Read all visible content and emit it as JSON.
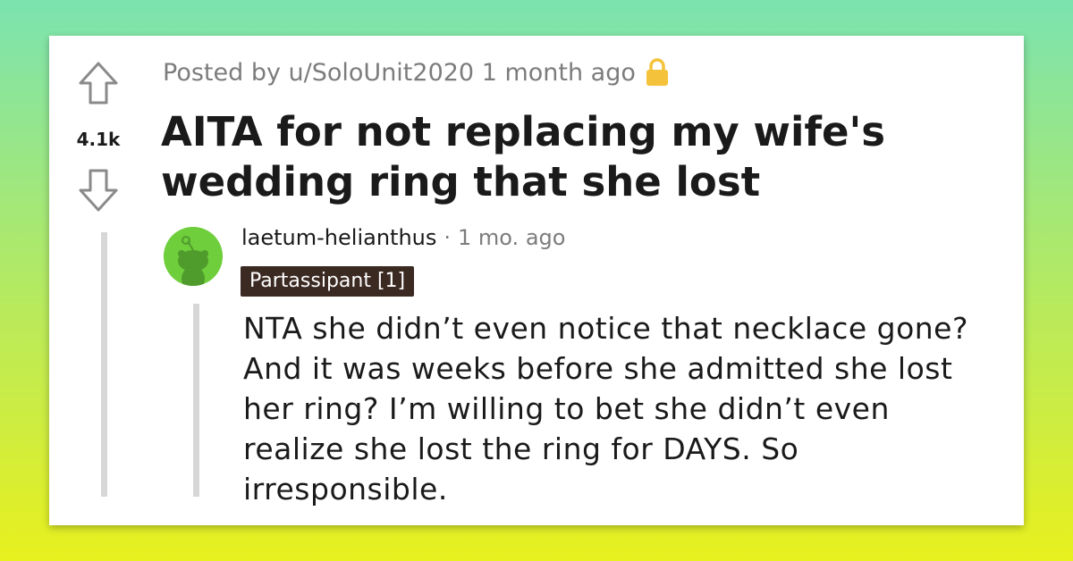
{
  "post": {
    "posted_by_prefix": "Posted by",
    "username": "u/SoloUnit2020",
    "time_ago": "1 month ago",
    "score": "4.1k",
    "title": "AITA for not replacing my wife's wedding ring that she lost",
    "lock_icon": "lock-icon",
    "upvote_icon": "upvote-arrow-icon",
    "downvote_icon": "downvote-arrow-icon"
  },
  "comment": {
    "author": "laetum-helianthus",
    "separator": "·",
    "time_ago": "1 mo. ago",
    "flair": "Partassipant [1]",
    "avatar_icon": "snoo-avatar-icon",
    "body": "NTA she didn’t even notice that necklace gone? And it was weeks before she admitted she lost her ring? I’m willing to bet she didn’t even realize she lost the ring for DAYS. So irresponsible."
  },
  "colors": {
    "background_top": "#7be3b0",
    "background_bottom": "#e8f01e",
    "card": "#ffffff",
    "flair_bg": "#3b2a22",
    "lock": "#f5c33b",
    "avatar_bg": "#6fce3c",
    "meta_text": "#7c7c7c",
    "title_text": "#1a1a1b"
  }
}
